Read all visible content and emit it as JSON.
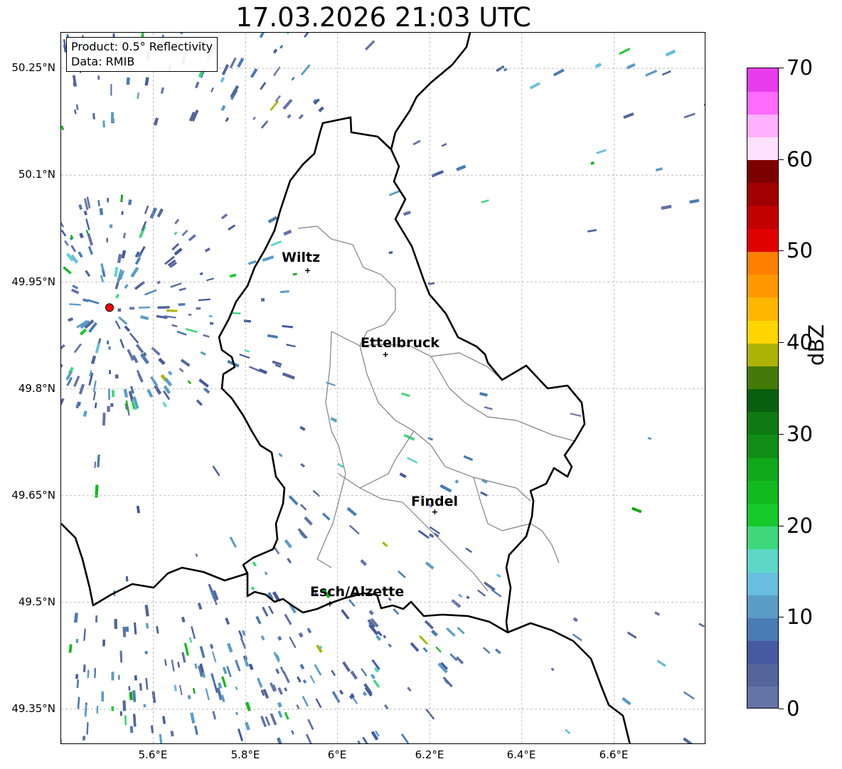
{
  "title": "17.03.2026 21:03 UTC",
  "info_box": {
    "product": "Product: 0.5° Reflectivity",
    "source": "Data: RMIB"
  },
  "map": {
    "lon_range": [
      5.4,
      6.8
    ],
    "lat_range": [
      49.3,
      50.3
    ],
    "lon_ticks": [
      "5.6°E",
      "5.8°E",
      "6°E",
      "6.2°E",
      "6.4°E",
      "6.6°E"
    ],
    "lat_ticks": [
      "50.25°N",
      "50.1°N",
      "49.95°N",
      "49.8°N",
      "49.65°N",
      "49.5°N",
      "49.35°N"
    ],
    "grid": true,
    "radar_site": {
      "lon": 5.505,
      "lat": 49.914
    },
    "cities": [
      {
        "name": "Wiltz",
        "lon": 5.935,
        "lat": 49.966
      },
      {
        "name": "Ettelbruck",
        "lon": 6.104,
        "lat": 49.848
      },
      {
        "name": "Findel",
        "lon": 6.211,
        "lat": 49.627
      },
      {
        "name": "Esch/Alzette",
        "lon": 5.983,
        "lat": 49.498
      }
    ]
  },
  "colorbar": {
    "label": "dBZ",
    "min": 0,
    "max": 70,
    "ticks": [
      "0",
      "10",
      "20",
      "30",
      "40",
      "50",
      "60",
      "70"
    ],
    "colors": [
      "#6473a6",
      "#53659a",
      "#455aa0",
      "#4a7bb4",
      "#5b9cc6",
      "#68bede",
      "#5dd6c8",
      "#3fd77b",
      "#16c92a",
      "#12b91f",
      "#11a81b",
      "#118d15",
      "#0f7a12",
      "#0a5f0e",
      "#447a08",
      "#adb307",
      "#ffd500",
      "#ffb700",
      "#ff9800",
      "#ff7f00",
      "#e10000",
      "#c30000",
      "#a00000",
      "#7d0000",
      "#ffe0ff",
      "#ffb1ff",
      "#ff6cff",
      "#e93ced"
    ]
  },
  "palette": {
    "background": "#ffffff",
    "country_border": "#000000",
    "canton_border": "#808080",
    "grid": "#b0b0b0",
    "radar_marker": "#ff0000"
  }
}
